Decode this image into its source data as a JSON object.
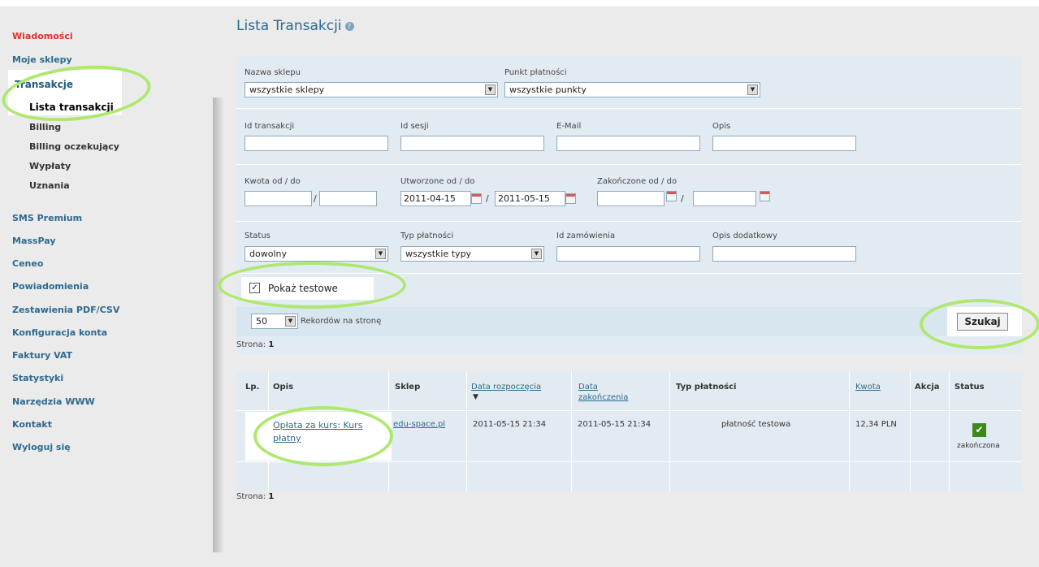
{
  "sidebar": {
    "items": [
      {
        "label": "Wiadomości",
        "style": "red"
      },
      {
        "label": "Moje sklepy",
        "style": "normal"
      },
      {
        "label": "Transakcje",
        "style": "active"
      },
      {
        "label": "Lista transakcji",
        "style": "current"
      },
      {
        "label": "Billing",
        "style": "sub"
      },
      {
        "label": "Billing oczekujący",
        "style": "sub"
      },
      {
        "label": "Wypłaty",
        "style": "sub"
      },
      {
        "label": "Uznania",
        "style": "sub"
      },
      {
        "label": "SMS Premium",
        "style": "normal"
      },
      {
        "label": "MassPay",
        "style": "normal"
      },
      {
        "label": "Ceneo",
        "style": "normal"
      },
      {
        "label": "Powiadomienia",
        "style": "normal"
      },
      {
        "label": "Zestawienia PDF/CSV",
        "style": "normal"
      },
      {
        "label": "Konfiguracja konta",
        "style": "normal"
      },
      {
        "label": "Faktury VAT",
        "style": "normal"
      },
      {
        "label": "Statystyki",
        "style": "normal"
      },
      {
        "label": "Narzędzia WWW",
        "style": "normal"
      },
      {
        "label": "Kontakt",
        "style": "normal"
      },
      {
        "label": "Wyloguj się",
        "style": "normal"
      }
    ]
  },
  "page": {
    "title": "Lista Transakcji",
    "help_icon": "?"
  },
  "filters": {
    "shop_label": "Nazwa sklepu",
    "shop_value": "wszystkie sklepy",
    "point_label": "Punkt płatności",
    "point_value": "wszystkie punkty",
    "transaction_id_label": "Id transakcji",
    "session_id_label": "Id sesji",
    "email_label": "E-Mail",
    "description_label": "Opis",
    "amount_label": "Kwota od / do",
    "created_label": "Utworzone od / do",
    "created_from": "2011-04-15",
    "created_to": "2011-05-15",
    "finished_label": "Zakończone od / do",
    "status_label": "Status",
    "status_value": "dowolny",
    "payment_type_label": "Typ płatności",
    "payment_type_value": "wszystkie typy",
    "order_id_label": "Id zamówienia",
    "extra_desc_label": "Opis dodatkowy",
    "show_test_label": "Pokaż testowe",
    "show_test_checked": "✓",
    "per_page_value": "50",
    "per_page_label": "Rekordów na stronę",
    "search_button": "Szukaj",
    "slash": "/"
  },
  "pagination": {
    "label": "Strona:",
    "page": "1"
  },
  "table": {
    "headers": {
      "lp": "Lp.",
      "opis": "Opis",
      "sklep": "Sklep",
      "data_rozpoczecia": "Data rozpoczęcia",
      "sort_arrow": "▼",
      "data_zakonczenia_1": "Data",
      "data_zakonczenia_2": "zakończenia",
      "typ_platnosci": "Typ płatności",
      "kwota": "Kwota",
      "akcja": "Akcja",
      "status": "Status"
    },
    "rows": [
      {
        "opis_1": "Opłata za kurs: Kurs",
        "opis_2": "płatny",
        "sklep": "edu-space.pl",
        "data_rozpoczecia": "2011-05-15 21:34",
        "data_zakonczenia": "2011-05-15 21:34",
        "typ_platnosci": "płatność testowa",
        "kwota": "12,34 PLN",
        "status_icon": "✔",
        "status": "zakończona"
      }
    ]
  },
  "colors": {
    "accent": "#2b6a8f",
    "alert": "#e0302a",
    "annotation": "#aee86f",
    "success": "#3a8a1a"
  }
}
